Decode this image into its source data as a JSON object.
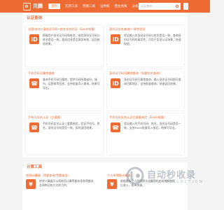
{
  "header": {
    "brand": "贝腾",
    "nav": [
      "首页",
      "实用工具",
      "营销工具",
      "证件照",
      "营业执照",
      "分类"
    ],
    "search_placeholder": "认证查询"
  },
  "sections": {
    "auth_title": "认证查询",
    "tools_title": "计算工具"
  },
  "cards": [
    {
      "title": "全国(实名)·身份证号码+姓名实名验证（Excel批量）",
      "desc": "根据用户身份证号码和姓名，核验身份证号码与姓名是否一致，相关信息是否真实有效，返回核验结果。",
      "icon": "ID"
    },
    {
      "title": "身份证实名查询/一致性验证",
      "desc": "验证输入的身份证号码与姓名是否一致，查询身份证号码的真实性，可用于实名认证场景，快速校验。",
      "icon": "ID"
    },
    {
      "title": "手机号码归属地查询",
      "desc": "查询手机号码归属地，提供号码所属省份、城市、运营商等信息，支持批量导入查询，结果可导出。",
      "icon": "☎"
    },
    {
      "title": "身份证号码归属地查询（批量实名查询）",
      "desc": "身份证号码归属地查询，输入身份证号码即可查询归属地区，支持批量查询，快速返回结果。",
      "icon": "ID"
    },
    {
      "title": "手机号实名认证（三要素）",
      "desc": "手机号码实名认证三要素核验，验证手机号、姓名、身份证号码是否一致，实时返回结果。",
      "icon": "☎"
    },
    {
      "title": "手机号码实名认证三要素核验（Excel批量）",
      "desc": "验证输入的手机号码、姓名、身份证号码是否一致，支持Excel批量导入核验，结果可导出。",
      "icon": "☎"
    }
  ],
  "tools": [
    {
      "title": "房贷计算器（等额本息/等额本金）",
      "desc": "房贷计算器可以帮助您计算等额本息和等额本金两种还款方式的月供。",
      "icon": "¥"
    },
    {
      "title": "个人所得税计算器",
      "desc": "根据最新个人所得税法计算您的应纳税额和税后收入，简单快捷。",
      "icon": "¥"
    }
  ],
  "watermark": {
    "text": "自动秒收录",
    "sub": "SITE COLLECTION"
  },
  "colors": {
    "accent": "#ef6b34"
  }
}
